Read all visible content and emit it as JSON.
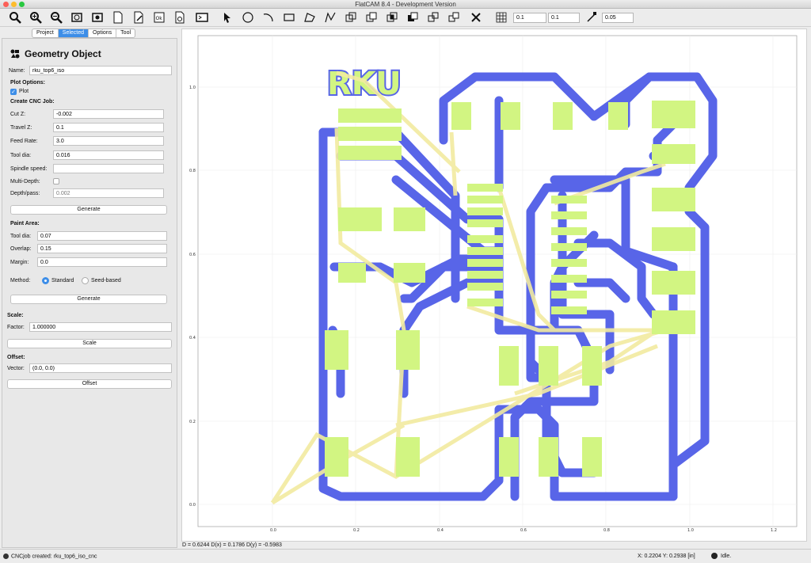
{
  "window": {
    "title": "FlatCAM 8.4 - Development Version"
  },
  "toolbar": {
    "icons": [
      "zoom-fit-icon",
      "zoom-in-icon",
      "zoom-out-icon",
      "redraw-icon",
      "replot-icon",
      "new-geometry-icon",
      "edit-geometry-icon",
      "update-geometry-icon",
      "move-icon",
      "shell-icon",
      "pointer-icon",
      "circle-icon",
      "arc-icon",
      "rectangle-icon",
      "polygon-icon",
      "path-icon",
      "union-icon",
      "cut-icon",
      "intersection-icon",
      "subtract-icon",
      "copy-icon",
      "delete-icon",
      "grid-icon",
      "snap-icon"
    ],
    "grid_x": "0.1",
    "grid_y": "0.1",
    "snap_max": "0.05"
  },
  "tabs": [
    "Project",
    "Selected",
    "Options",
    "Tool"
  ],
  "active_tab": "Selected",
  "panel": {
    "header": "Geometry Object",
    "name_label": "Name:",
    "name_value": "rku_top6_iso",
    "plot_options": "Plot Options:",
    "plot_label": "Plot",
    "create_cnc": "Create CNC Job:",
    "cut_z_label": "Cut Z:",
    "cut_z": "-0.002",
    "travel_z_label": "Travel Z:",
    "travel_z": "0.1",
    "feed_rate_label": "Feed Rate:",
    "feed_rate": "3.0",
    "tool_dia_label": "Tool dia:",
    "tool_dia": "0.016",
    "spindle_label": "Spindle speed:",
    "spindle": "",
    "multidepth_label": "Multi-Depth:",
    "depth_pass_label": "Depth/pass:",
    "depth_pass": "0.002",
    "generate_label": "Generate",
    "paint_area": "Paint Area:",
    "paint_tool_dia_label": "Tool dia:",
    "paint_tool_dia": "0.07",
    "overlap_label": "Overlap:",
    "overlap": "0.15",
    "margin_label": "Margin:",
    "margin": "0.0",
    "method_label": "Method:",
    "method_standard": "Standard",
    "method_seed": "Seed-based",
    "paint_generate_label": "Generate",
    "scale_title": "Scale:",
    "factor_label": "Factor:",
    "factor": "1.000000",
    "scale_button": "Scale",
    "offset_title": "Offset:",
    "vector_label": "Vector:",
    "vector": "(0.0, 0.0)",
    "offset_button": "Offset"
  },
  "plot": {
    "x_ticks": [
      "0.0",
      "0.2",
      "0.4",
      "0.6",
      "0.8",
      "1.0",
      "1.2"
    ],
    "y_ticks": [
      "0.0",
      "0.2",
      "0.4",
      "0.6",
      "0.8",
      "1.0"
    ],
    "logo_text": "RKU",
    "colors": {
      "trace": "#5865e8",
      "pad": "#d2f582",
      "travel": "#f2eba0"
    }
  },
  "status": {
    "distance": "D = 0.6244  D(x) = 0.1786  D(y) = -0.5983",
    "message": "CNCjob created: rku_top6_iso_cnc",
    "coords": "X: 0.2204   Y: 0.2938   [in]",
    "state": "Idle."
  }
}
